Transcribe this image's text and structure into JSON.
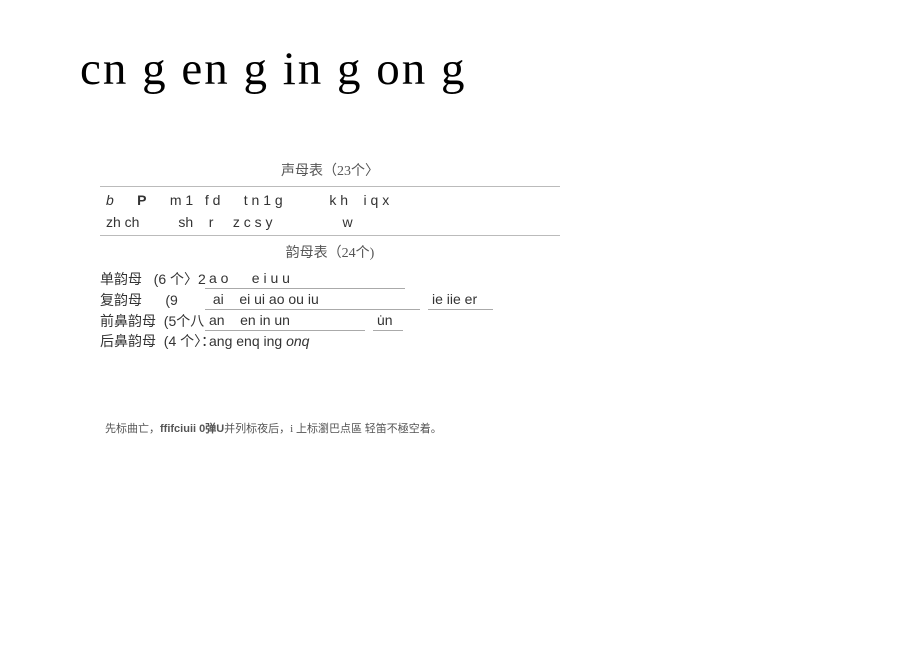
{
  "title": "cn g en g in g on g",
  "shengmu": {
    "heading": "声母表（23个〉",
    "row1": "b      P      m 1   f d      t n 1 g            k h    i q x",
    "row2": "zh ch          sh    r     z c s y                  w"
  },
  "yunmu": {
    "heading": "韵母表（24个)",
    "rows": [
      {
        "label": "单韵母   (6 个〉2",
        "c1": "a o      e i u u",
        "c2": "",
        "c3": ""
      },
      {
        "label": "复韵母      (9",
        "c1": " ai    ei ui ao ou iu",
        "c2": "ie iie er",
        "c3": ""
      },
      {
        "label": "前鼻韵母  (5个八",
        "c1": "an    en in un",
        "c2": "",
        "c3": "u̇n"
      },
      {
        "label": "后鼻韵母  (4 个〉：",
        "c1": "ang    enq ing ",
        "c1_it": "onq",
        "c2": "",
        "c3": ""
      }
    ]
  },
  "footnote": {
    "pre": "先标曲亡，",
    "mid": "ffifciuii 0弹U",
    "post": "并列标夜后，i 上标瀏巴点區  轻笛不極空着。"
  }
}
